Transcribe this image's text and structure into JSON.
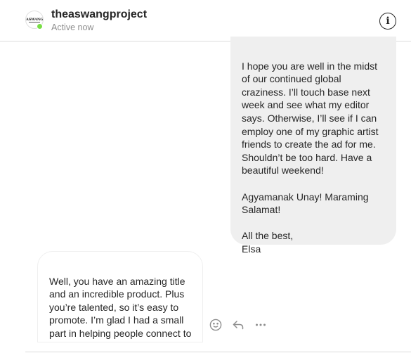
{
  "header": {
    "username": "theaswangproject",
    "status": "Active now",
    "avatar_text": "ASWANG"
  },
  "messages": {
    "outgoing": "I hope you are well in the midst of our continued global craziness. I’ll touch base next week and see what my editor says. Otherwise, I’ll see if I can employ one of my graphic artist friends to create the ad for me. Shouldn’t be too hard. Have a beautiful weekend!\n\nAgyamanak Unay! Maraming Salamat!\n\nAll the best,\nElsa",
    "incoming": "Well, you have an amazing title and an incredible product. Plus you’re talented, so it’s easy to promote. I’m glad I had a small part in helping people connect to it."
  },
  "actions": {
    "icons": [
      "emoji-icon",
      "reply-icon",
      "more-options-icon"
    ]
  },
  "colors": {
    "online": "#78de45",
    "outgoing_bubble": "#efefef",
    "muted_text": "#8e8e8e"
  }
}
